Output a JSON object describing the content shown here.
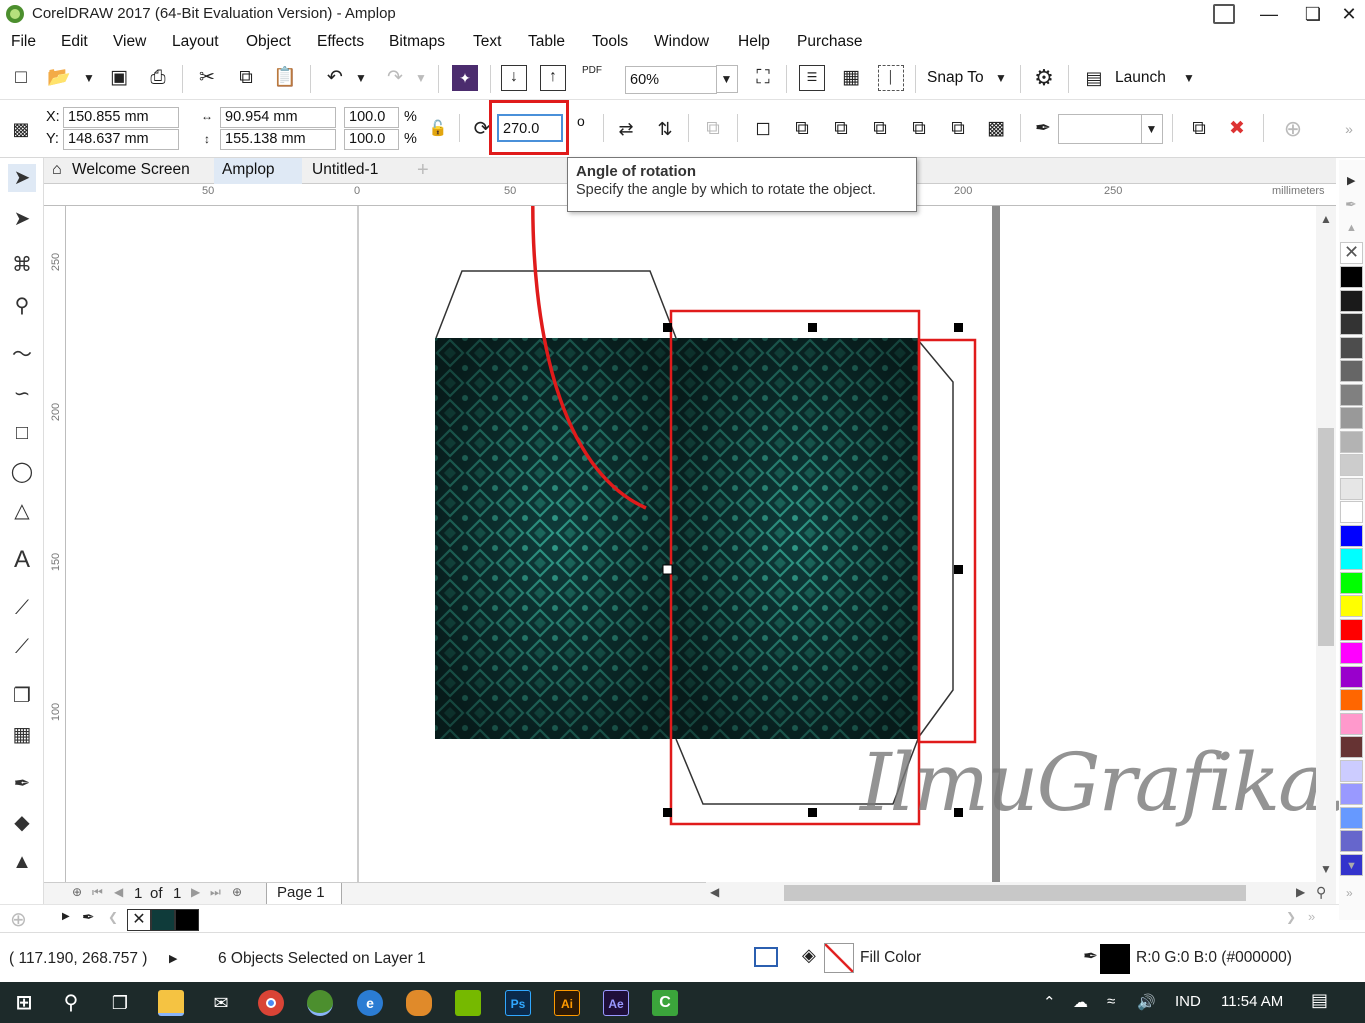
{
  "window": {
    "title": "CorelDRAW 2017 (64-Bit Evaluation Version) - Amplop"
  },
  "menu": [
    "File",
    "Edit",
    "View",
    "Layout",
    "Object",
    "Effects",
    "Bitmaps",
    "Text",
    "Table",
    "Tools",
    "Window",
    "Help",
    "Purchase"
  ],
  "standard_toolbar": {
    "zoom": "60%",
    "snap_to": "Snap To",
    "launch": "Launch",
    "pdf": "PDF"
  },
  "property_bar": {
    "x_label": "X:",
    "x_value": "150.855 mm",
    "y_label": "Y:",
    "y_value": "148.637 mm",
    "width_value": "90.954 mm",
    "height_value": "155.138 mm",
    "scale_x": "100.0",
    "scale_y": "100.0",
    "percent": "%",
    "rotation": "270.0",
    "degree": "o"
  },
  "tabs": [
    "Welcome Screen",
    "Amplop",
    "Untitled-1"
  ],
  "ruler": {
    "h_ticks": [
      "50",
      "0",
      "50",
      "200",
      "250"
    ],
    "unit": "millimeters",
    "v_ticks": [
      "250",
      "200",
      "150",
      "100"
    ]
  },
  "tooltip": {
    "title": "Angle of rotation",
    "description": "Specify the angle by which to rotate the object."
  },
  "page_nav": {
    "current": "1",
    "of": "of",
    "total": "1",
    "page_tab": "Page 1"
  },
  "status": {
    "coords": "( 117.190, 268.757 )",
    "selection": "6 Objects Selected on Layer 1",
    "fill": "Fill Color",
    "outline": "R:0 G:0 B:0 (#000000)"
  },
  "watermark": "IlmuGrafika.id",
  "taskbar": {
    "lang": "IND",
    "time": "11:54 AM",
    "apps": [
      "Ps",
      "Ai",
      "Ae"
    ]
  },
  "colors": {
    "pattern_dark": "#0f3b3a",
    "pattern_light": "#2f9a88",
    "highlight_red": "#e01b1b",
    "palette": [
      "#000000",
      "#1a1a1a",
      "#333333",
      "#4d4d4d",
      "#666666",
      "#808080",
      "#999999",
      "#b3b3b3",
      "#cccccc",
      "#e6e6e6",
      "#ffffff",
      "#0000ff",
      "#00ffff",
      "#00ff00",
      "#ffff00",
      "#ff0000",
      "#ff00ff",
      "#9900cc",
      "#ff6600",
      "#ff99cc",
      "#663333",
      "#ccccff",
      "#9999ff",
      "#6699ff",
      "#6666cc",
      "#3333cc"
    ]
  }
}
